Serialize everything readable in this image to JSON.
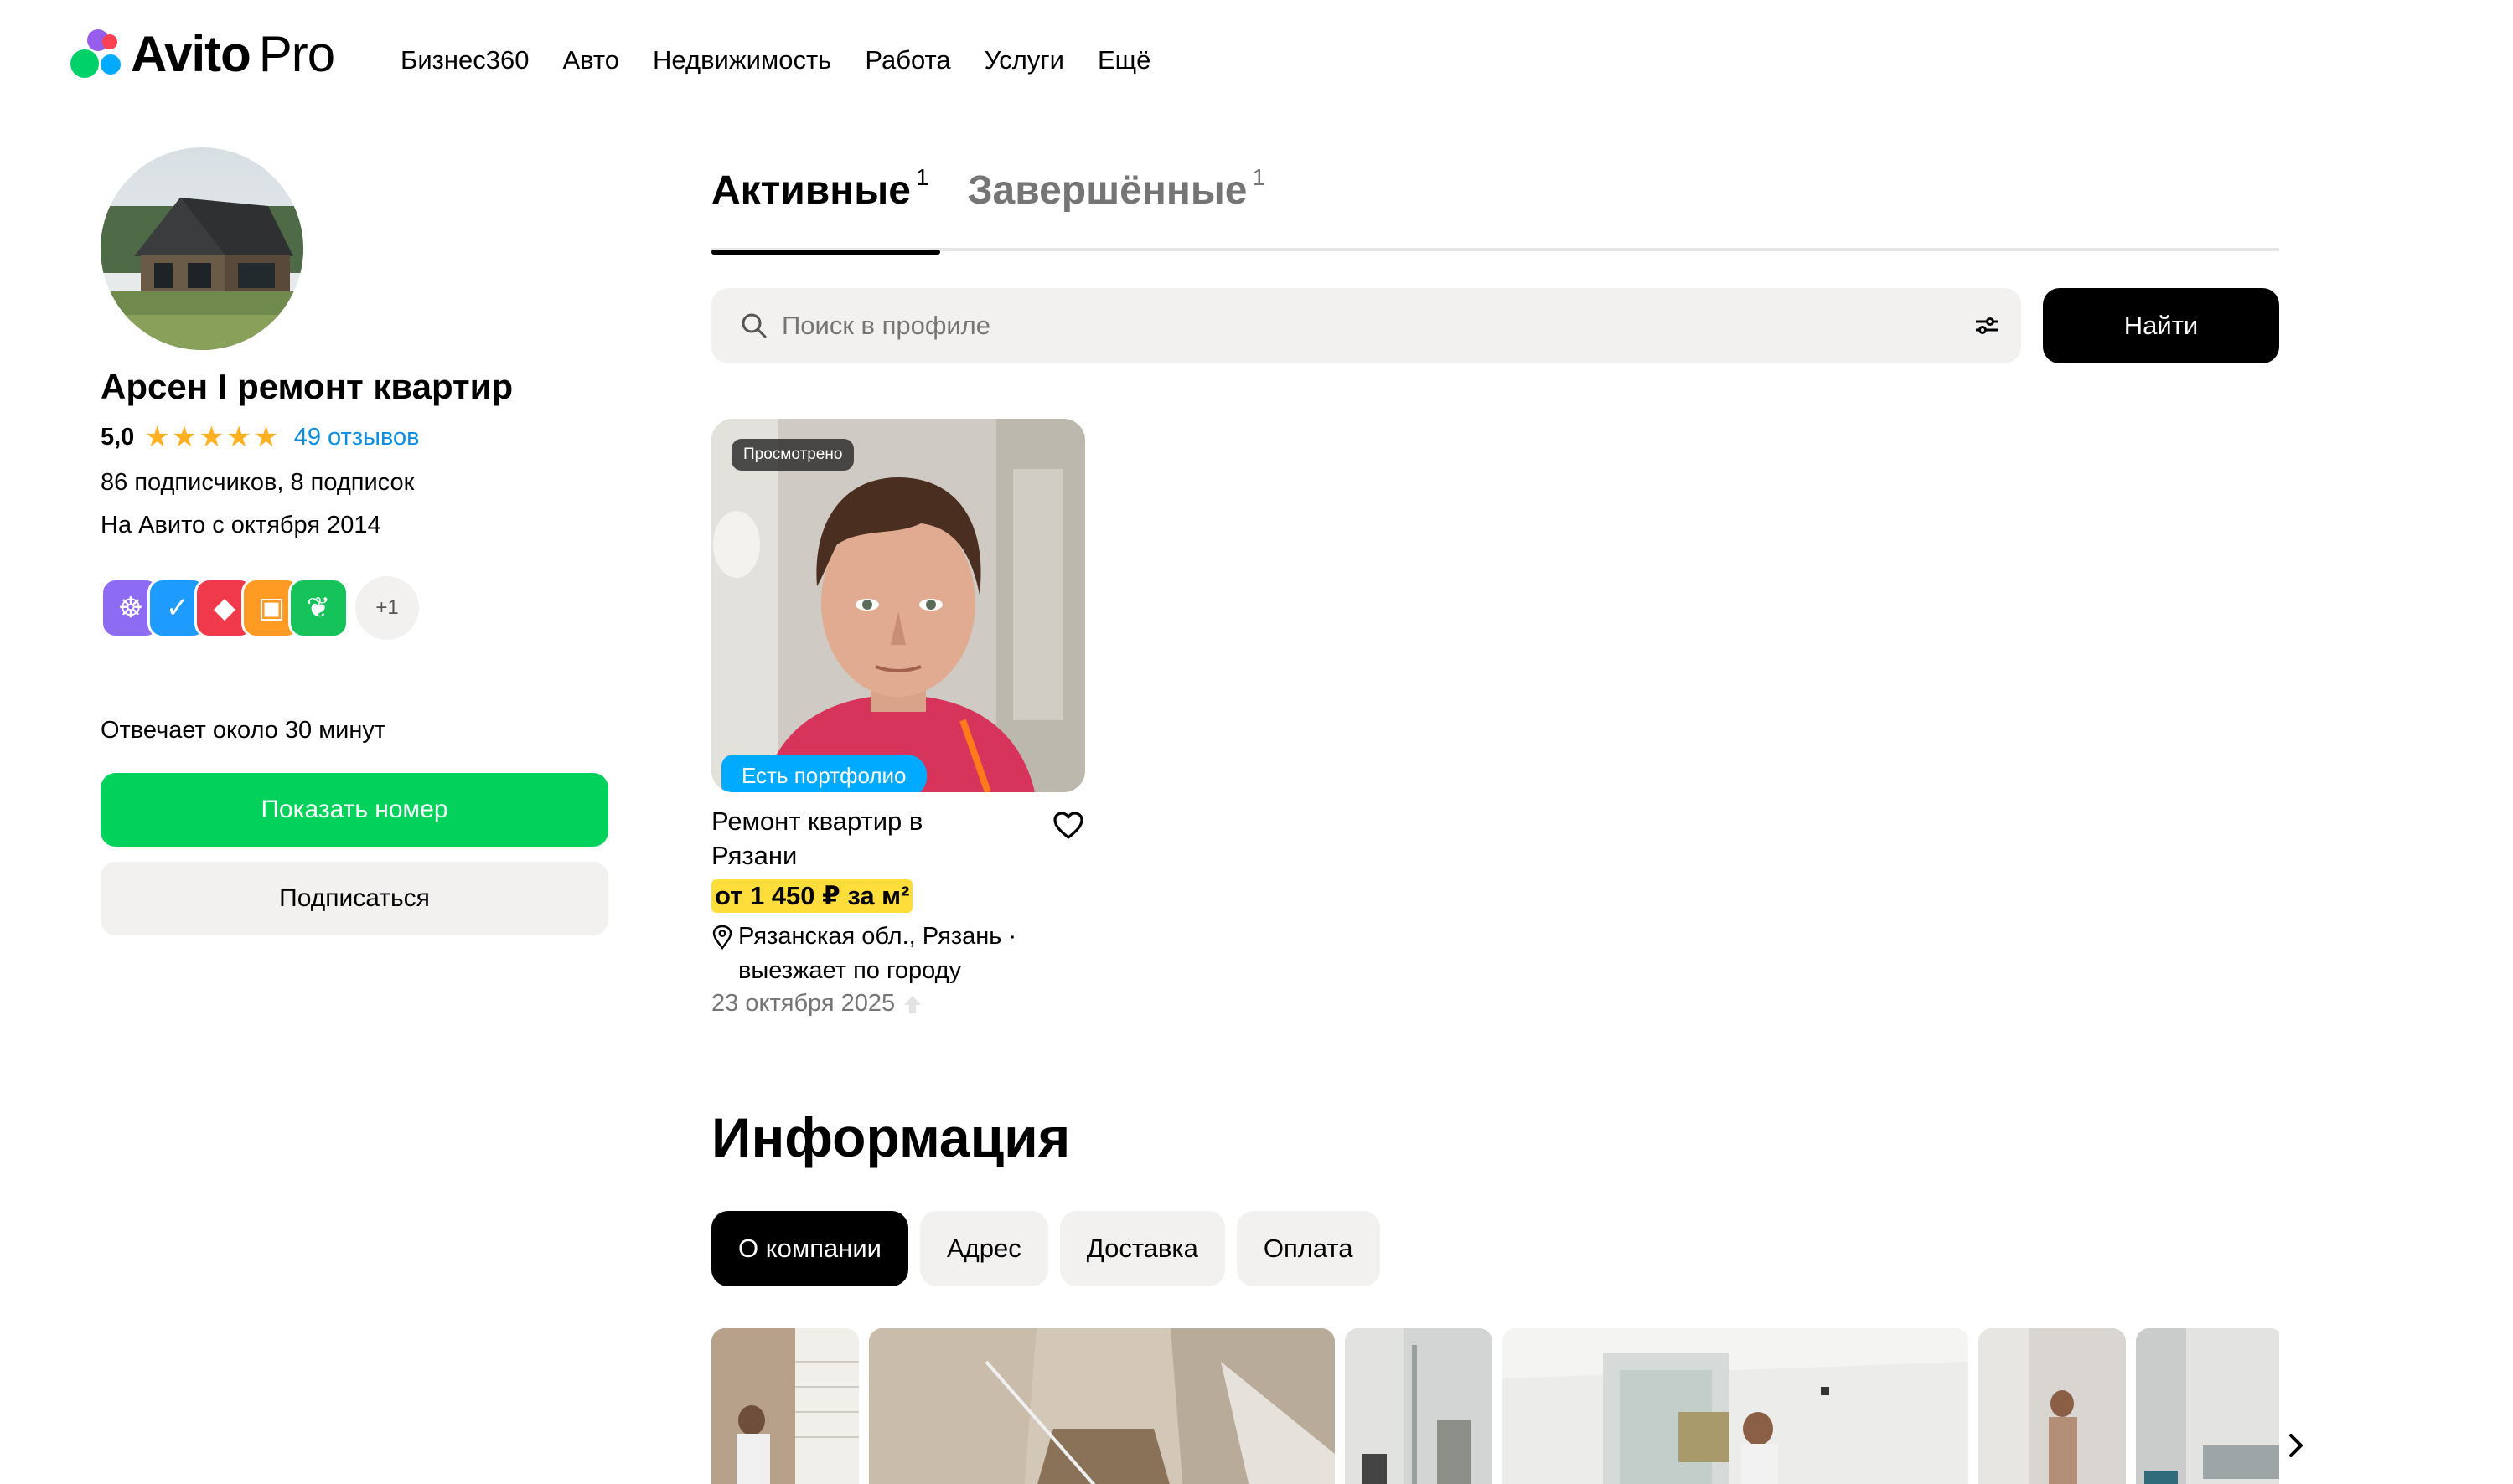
{
  "header": {
    "logo_main": "Avito",
    "logo_sub": "Pro",
    "nav": [
      "Бизнес360",
      "Авто",
      "Недвижимость",
      "Работа",
      "Услуги",
      "Ещё"
    ]
  },
  "profile": {
    "name": "Арсен I ремонт квартир",
    "rating": "5,0",
    "stars": 5,
    "reviews": "49 отзывов",
    "followers": "86 подписчиков, 8 подписок",
    "since": "На Авито с октября 2014",
    "badges_more": "+1",
    "response_time": "Отвечает около 30 минут",
    "show_phone": "Показать номер",
    "subscribe": "Подписаться"
  },
  "tabs": [
    {
      "label": "Активные",
      "count": "1",
      "active": true
    },
    {
      "label": "Завершённые",
      "count": "1",
      "active": false
    }
  ],
  "search": {
    "placeholder": "Поиск в профиле",
    "button": "Найти"
  },
  "listing": {
    "viewed_label": "Просмотрено",
    "portfolio_label": "Есть портфолио",
    "title": "Ремонт квартир в Рязани",
    "price": "от 1 450 ₽ за м²",
    "location": "Рязанская обл., Рязань · выезжает по городу",
    "date": "23 октября 2025"
  },
  "info": {
    "title": "Информация",
    "tabs": [
      "О компании",
      "Адрес",
      "Доставка",
      "Оплата"
    ],
    "active_tab": "О компании"
  },
  "colors": {
    "accent_green": "#02d15c",
    "link_blue": "#0a8ee0",
    "price_highlight": "#ffde3b",
    "portfolio_badge": "#00aaff"
  }
}
